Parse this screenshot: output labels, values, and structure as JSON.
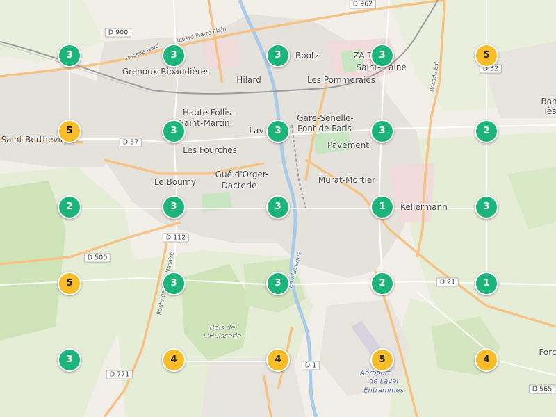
{
  "map": {
    "colors": {
      "low": "#1db47b",
      "high": "#f6bd29",
      "land": "#f2efe9",
      "forest": "#cfe3b8",
      "field": "#e6edd6",
      "urban": "#e4e0da",
      "water": "#a9cbe8",
      "road_major": "#f9c98f",
      "road_minor": "#ffffff",
      "rail": "#9c9c9c"
    },
    "places": [
      {
        "name": "Grenoux-Ribaudières",
        "style": "normal"
      },
      {
        "name": "Hilard",
        "style": "normal"
      },
      {
        "name": "Les Pommeraies",
        "style": "normal"
      },
      {
        "name": "-Bootz",
        "style": "normal"
      },
      {
        "name": "ZA T",
        "style": "normal"
      },
      {
        "name": "Saint-",
        "style": "normal"
      },
      {
        "name": "aine",
        "style": "normal"
      },
      {
        "name": "Haute Follis-",
        "style": "normal"
      },
      {
        "name": "Saint-Martin",
        "style": "normal"
      },
      {
        "name": "Lav",
        "style": "normal"
      },
      {
        "name": "Gare-Senelle-",
        "style": "normal"
      },
      {
        "name": "Pont de Paris",
        "style": "normal"
      },
      {
        "name": "Pavement",
        "style": "normal"
      },
      {
        "name": "Saint-Berthevin",
        "style": "normal"
      },
      {
        "name": "Les Fourches",
        "style": "normal"
      },
      {
        "name": "Gué d'Orger-",
        "style": "normal"
      },
      {
        "name": "Dacterie",
        "style": "normal"
      },
      {
        "name": "Murat-Mortier",
        "style": "normal"
      },
      {
        "name": "Le Bourny",
        "style": "normal"
      },
      {
        "name": "Kellermann",
        "style": "normal"
      },
      {
        "name": "Bon",
        "style": "normal"
      },
      {
        "name": "lès",
        "style": "normal"
      },
      {
        "name": "Forc",
        "style": "normal"
      },
      {
        "name": "Bois de",
        "style": "italic"
      },
      {
        "name": "L'Huisserie",
        "style": "italic"
      },
      {
        "name": "Aéroport",
        "style": "airport"
      },
      {
        "name": "de Laval",
        "style": "airport"
      },
      {
        "name": "Entrammes",
        "style": "airport"
      },
      {
        "name": "La Mayenne",
        "style": "river"
      }
    ],
    "road_shields": [
      "D 962",
      "D 900",
      "D 57",
      "D 112",
      "D 500",
      "D 771",
      "D 1",
      "D 21",
      "D 565",
      "D 32"
    ],
    "street_labels": [
      "Rocade Nord",
      "levard Pierre Elain",
      "Rocade Est",
      "Route de Saint-Nazaire"
    ],
    "clusters": [
      {
        "count": "3",
        "level": "low"
      },
      {
        "count": "3",
        "level": "low"
      },
      {
        "count": "3",
        "level": "low"
      },
      {
        "count": "3",
        "level": "low"
      },
      {
        "count": "5",
        "level": "high"
      },
      {
        "count": "5",
        "level": "high"
      },
      {
        "count": "3",
        "level": "low"
      },
      {
        "count": "3",
        "level": "low"
      },
      {
        "count": "3",
        "level": "low"
      },
      {
        "count": "2",
        "level": "low"
      },
      {
        "count": "2",
        "level": "low"
      },
      {
        "count": "3",
        "level": "low"
      },
      {
        "count": "3",
        "level": "low"
      },
      {
        "count": "1",
        "level": "low"
      },
      {
        "count": "3",
        "level": "low"
      },
      {
        "count": "5",
        "level": "high"
      },
      {
        "count": "3",
        "level": "low"
      },
      {
        "count": "3",
        "level": "low"
      },
      {
        "count": "2",
        "level": "low"
      },
      {
        "count": "1",
        "level": "low"
      },
      {
        "count": "3",
        "level": "low"
      },
      {
        "count": "4",
        "level": "high"
      },
      {
        "count": "4",
        "level": "high"
      },
      {
        "count": "5",
        "level": "high"
      },
      {
        "count": "4",
        "level": "high"
      }
    ]
  }
}
